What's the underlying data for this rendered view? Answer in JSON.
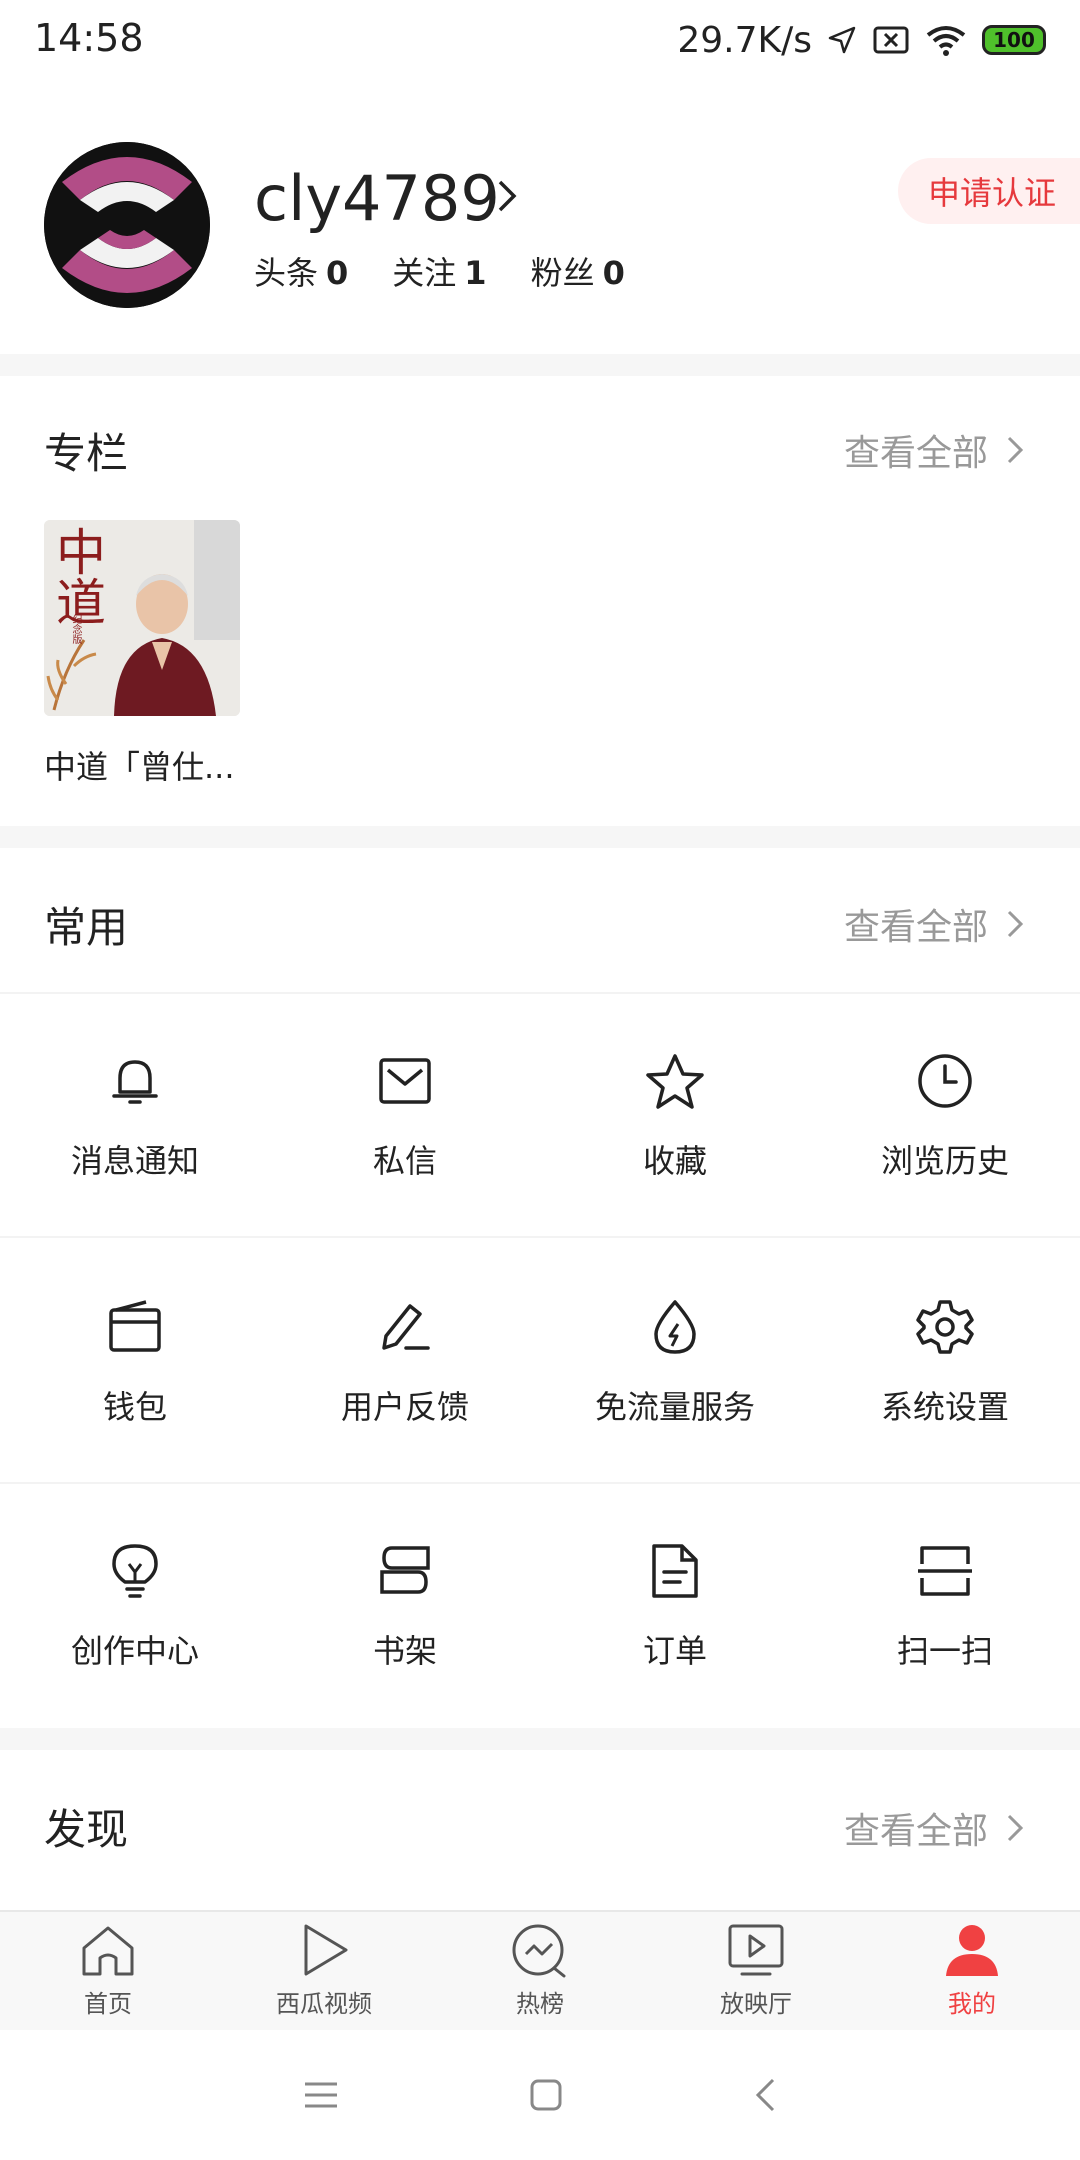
{
  "status": {
    "time": "14:58",
    "speed": "29.7K/s",
    "battery": "100"
  },
  "profile": {
    "username": "cly4789",
    "stats": [
      {
        "label": "头条",
        "value": "0"
      },
      {
        "label": "关注",
        "value": "1"
      },
      {
        "label": "粉丝",
        "value": "0"
      }
    ],
    "cert_button": "申请认证"
  },
  "columns": {
    "title": "专栏",
    "see_all": "查看全部",
    "item": {
      "caption": "中道「曾仕...",
      "cover_text": "中道",
      "cover_badge": "纪念版"
    }
  },
  "common": {
    "title": "常用",
    "see_all": "查看全部",
    "items": [
      {
        "label": "消息通知",
        "icon": "bell-icon"
      },
      {
        "label": "私信",
        "icon": "mail-icon"
      },
      {
        "label": "收藏",
        "icon": "star-icon"
      },
      {
        "label": "浏览历史",
        "icon": "clock-icon"
      },
      {
        "label": "钱包",
        "icon": "wallet-icon"
      },
      {
        "label": "用户反馈",
        "icon": "pen-icon"
      },
      {
        "label": "免流量服务",
        "icon": "drop-icon"
      },
      {
        "label": "系统设置",
        "icon": "gear-icon"
      },
      {
        "label": "创作中心",
        "icon": "bulb-icon"
      },
      {
        "label": "书架",
        "icon": "books-icon"
      },
      {
        "label": "订单",
        "icon": "document-icon"
      },
      {
        "label": "扫一扫",
        "icon": "scan-icon"
      }
    ]
  },
  "discover": {
    "title": "发现",
    "see_all": "查看全部"
  },
  "tabs": [
    {
      "label": "首页",
      "icon": "home-icon"
    },
    {
      "label": "西瓜视频",
      "icon": "play-icon"
    },
    {
      "label": "热榜",
      "icon": "trending-icon"
    },
    {
      "label": "放映厅",
      "icon": "screen-icon"
    },
    {
      "label": "我的",
      "icon": "person-icon",
      "active": true
    }
  ],
  "colors": {
    "accent": "#f04142",
    "cert_bg": "#fff0f0"
  }
}
